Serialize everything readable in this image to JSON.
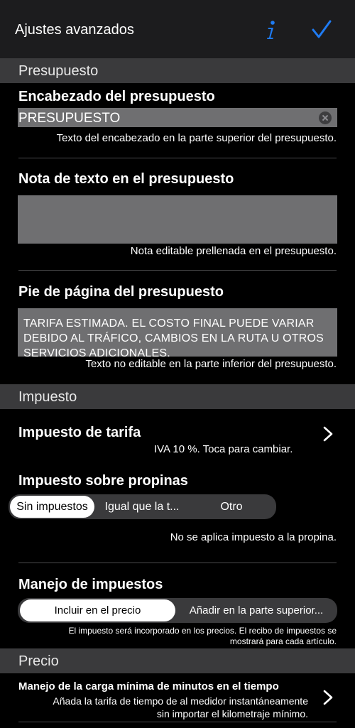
{
  "nav": {
    "title": "Ajustes avanzados",
    "info_icon": "info-icon",
    "done_icon": "checkmark-icon",
    "accent": "#1f7bf2"
  },
  "sections": {
    "quote": "Presupuesto",
    "tax": "Impuesto",
    "price": "Precio"
  },
  "quote_header": {
    "label": "Encabezado del presupuesto",
    "value": "PRESUPUESTO",
    "hint": "Texto del encabezado en la parte superior del presupuesto."
  },
  "quote_note": {
    "label": "Nota de texto en el presupuesto",
    "value": "",
    "hint": "Nota editable prellenada en el presupuesto."
  },
  "quote_footer": {
    "label": "Pie de página del presupuesto",
    "value": "TARIFA ESTIMADA. EL COSTO FINAL PUEDE VARIAR DEBIDO AL TRÁFICO, CAMBIOS EN LA RUTA U OTROS SERVICIOS ADICIONALES.",
    "hint": "Texto no editable en la parte inferior del presupuesto."
  },
  "fare_tax": {
    "label": "Impuesto de tarifa",
    "detail": "IVA 10 %. Toca para cambiar."
  },
  "tip_tax": {
    "label": "Impuesto sobre propinas",
    "options": [
      "Sin impuestos",
      "Igual que la t...",
      "Otro"
    ],
    "selected": "Sin impuestos",
    "hint": "No se aplica impuesto a la propina."
  },
  "tax_handling": {
    "label": "Manejo de impuestos",
    "options": [
      "Incluir en el precio",
      "Añadir en la parte superior..."
    ],
    "selected": "Incluir en el precio",
    "hint_line1": "El impuesto será incorporado en los precios. El recibo de impuestos se",
    "hint_line2": "mostrará para cada artículo."
  },
  "min_time": {
    "label": "Manejo de la carga mínima de minutos en el tiempo",
    "detail_line1": "Añada la tarifa de tiempo de al medidor instantáneamente",
    "detail_line2": "sin importar el kilometraje mínimo."
  }
}
